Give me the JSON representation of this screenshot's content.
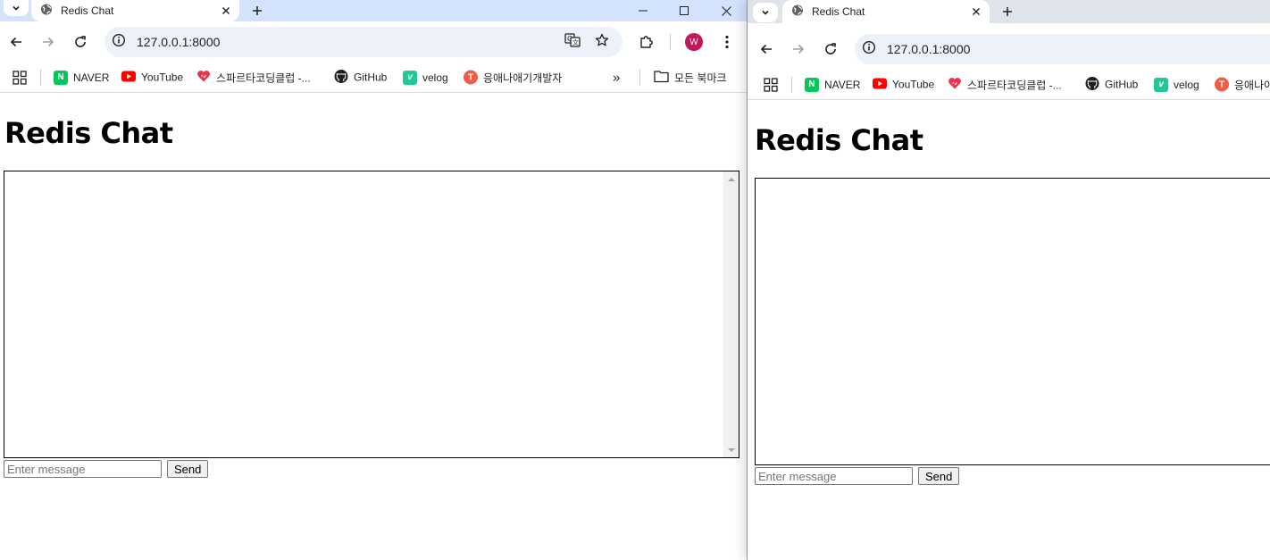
{
  "colors": {
    "tabstrip_active": "#d3e3fd",
    "tabstrip_inactive": "#dfe3ea",
    "omnibox_bg": "#edf2fa",
    "avatar": "#c2185b",
    "naver": "#03c75a",
    "youtube": "#ff0000",
    "velog": "#20c997",
    "sparta": "#e8344e",
    "blog": "#f25c45"
  },
  "browser": {
    "tab_title": "Redis Chat",
    "url": "127.0.0.1:8000",
    "avatar_letter": "W",
    "bookmarks": {
      "naver": "NAVER",
      "youtube": "YouTube",
      "sparta": "스파르타코딩클럽 -...",
      "github": "GitHub",
      "velog": "velog",
      "blog_full": "응애나애기개발자",
      "blog_cut": "응애나아",
      "more": "»",
      "all_bookmarks": "모든 북마크"
    }
  },
  "page": {
    "title": "Redis Chat",
    "input_placeholder": "Enter message",
    "send_label": "Send"
  }
}
